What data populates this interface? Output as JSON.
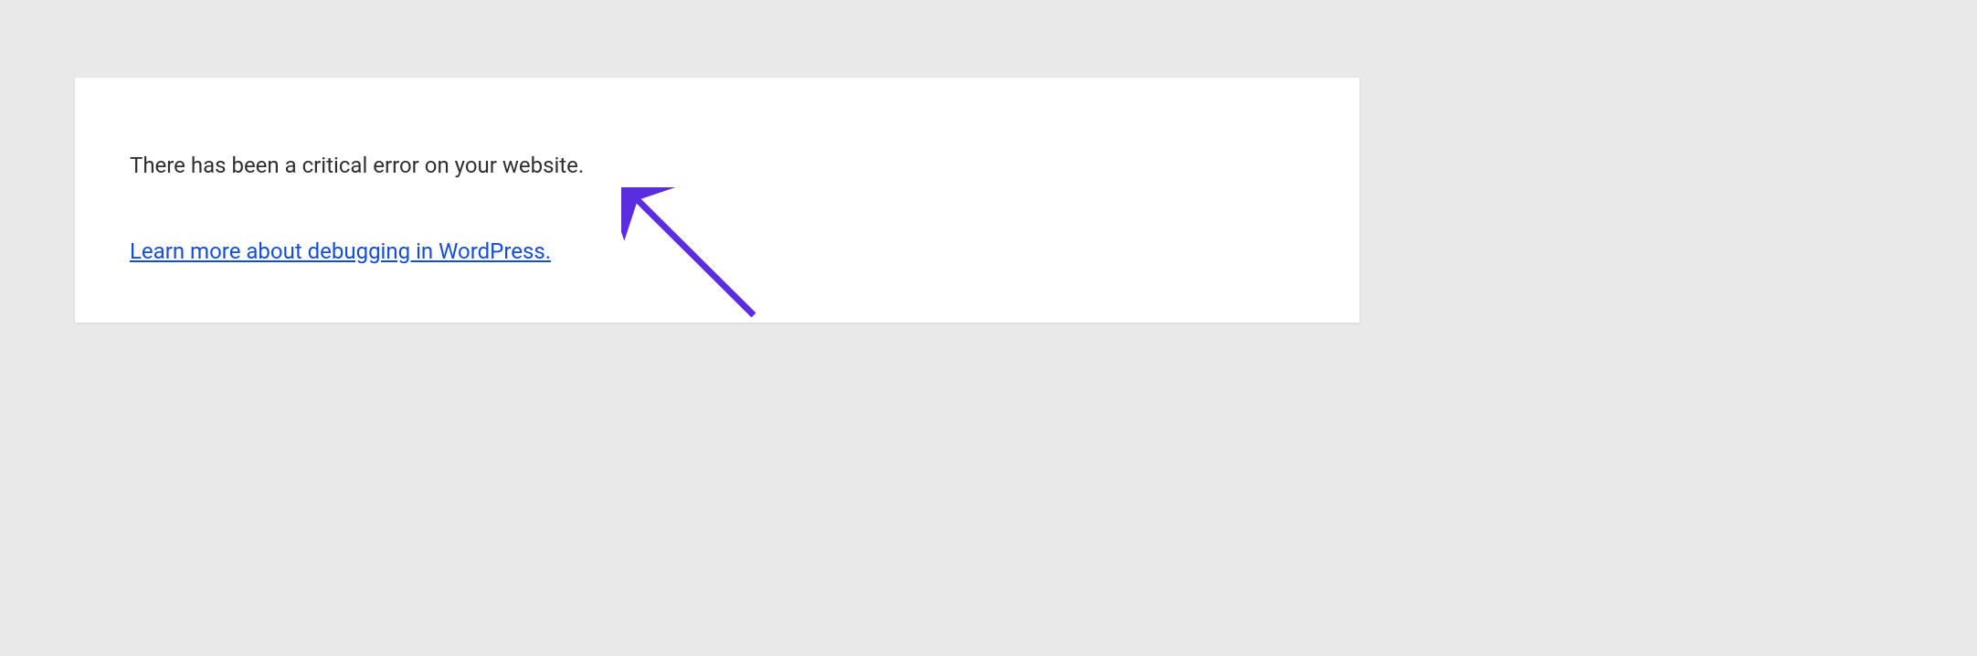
{
  "error": {
    "message": "There has been a critical error on your website.",
    "linkText": "Learn more about debugging in WordPress."
  },
  "annotation": {
    "arrowColor": "#5b2de0"
  }
}
